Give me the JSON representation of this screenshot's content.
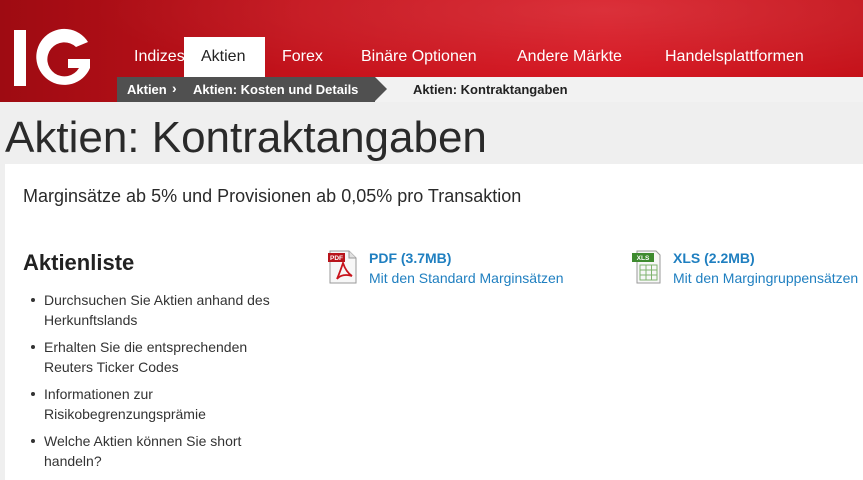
{
  "brand": {
    "logo_text": "IG",
    "color": "#d6141f"
  },
  "nav": {
    "items": [
      {
        "label": "Indizes",
        "active": false
      },
      {
        "label": "Aktien",
        "active": true
      },
      {
        "label": "Forex",
        "active": false
      },
      {
        "label": "Binäre Optionen",
        "active": false
      },
      {
        "label": "Andere Märkte",
        "active": false
      },
      {
        "label": "Handelsplattformen",
        "active": false
      }
    ]
  },
  "breadcrumb": {
    "items": [
      "Aktien",
      "Aktien: Kosten und Details",
      "Aktien: Kontraktangaben"
    ],
    "separator": "›"
  },
  "page": {
    "title": "Aktien: Kontraktangaben",
    "subtitle": "Marginsätze ab 5% und Provisionen ab 0,05% pro Transaktion"
  },
  "stock_list": {
    "heading": "Aktienliste",
    "bullets": [
      "Durchsuchen Sie Aktien anhand des Herkunftslands",
      "Erhalten Sie die entsprechenden Reuters Ticker Codes",
      "Informationen zur Risikobegrenzungsprämie",
      "Welche Aktien können Sie short handeln?"
    ]
  },
  "downloads": {
    "pdf": {
      "icon": "pdf-file-icon",
      "icon_label": "PDF",
      "title": "PDF (3.7MB)",
      "subtitle": "Mit den Standard Marginsätzen"
    },
    "xls": {
      "icon": "xls-file-icon",
      "icon_label": "XLS",
      "title": "XLS (2.2MB)",
      "subtitle": "Mit den Margingruppensätzen"
    }
  },
  "colors": {
    "link": "#1f7fc0",
    "breadcrumb_dark": "#505050",
    "band_gray": "#efefef"
  }
}
